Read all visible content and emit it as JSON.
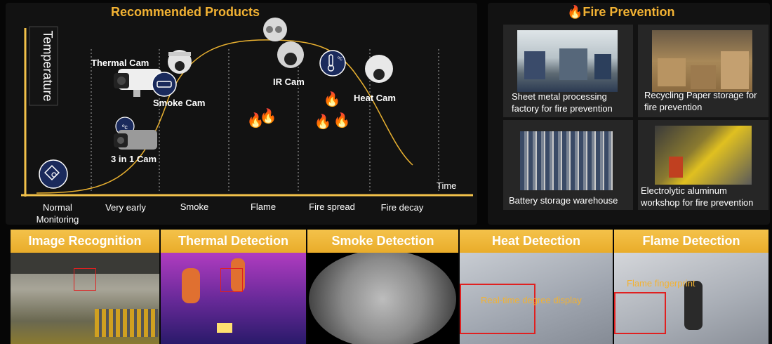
{
  "recommended": {
    "title": "Recommended Products",
    "axis_y": "Temperature",
    "axis_x": "Time",
    "stages": [
      "Normal\nMonitoring",
      "Very early",
      "Smoke",
      "Flame",
      "Fire spread",
      "Fire decay"
    ],
    "products": [
      {
        "label": "Thermal Cam",
        "icon": "thermal-camera-icon"
      },
      {
        "label": "Smoke Cam",
        "icon": "smoke-camera-icon"
      },
      {
        "label": "3 in 1 Cam",
        "icon": "3in1-camera-icon"
      },
      {
        "label": "IR Cam",
        "icon": "ir-camera-icon"
      },
      {
        "label": "Heat Cam",
        "icon": "heat-camera-icon"
      }
    ]
  },
  "fire_prevention": {
    "title": "Fire Prevention",
    "title_icon": "flame-icon",
    "cards": [
      {
        "caption": "Sheet metal processing factory for fire prevention"
      },
      {
        "caption": "Recycling Paper storage for fire prevention"
      },
      {
        "caption": "Battery storage warehouse"
      },
      {
        "caption": "Electrolytic aluminum workshop for fire prevention"
      }
    ]
  },
  "detection": [
    {
      "title": "Image Recognition"
    },
    {
      "title": "Thermal Detection"
    },
    {
      "title": "Smoke Detection"
    },
    {
      "title": "Heat Detection",
      "overlay": "Real-time degree display"
    },
    {
      "title": "Flame Detection",
      "overlay": "Flame fingerprint"
    }
  ],
  "colors": {
    "accent": "#f2b233",
    "curve": "#e8b030",
    "axis": "#f2c14a",
    "panel": "#121212"
  }
}
